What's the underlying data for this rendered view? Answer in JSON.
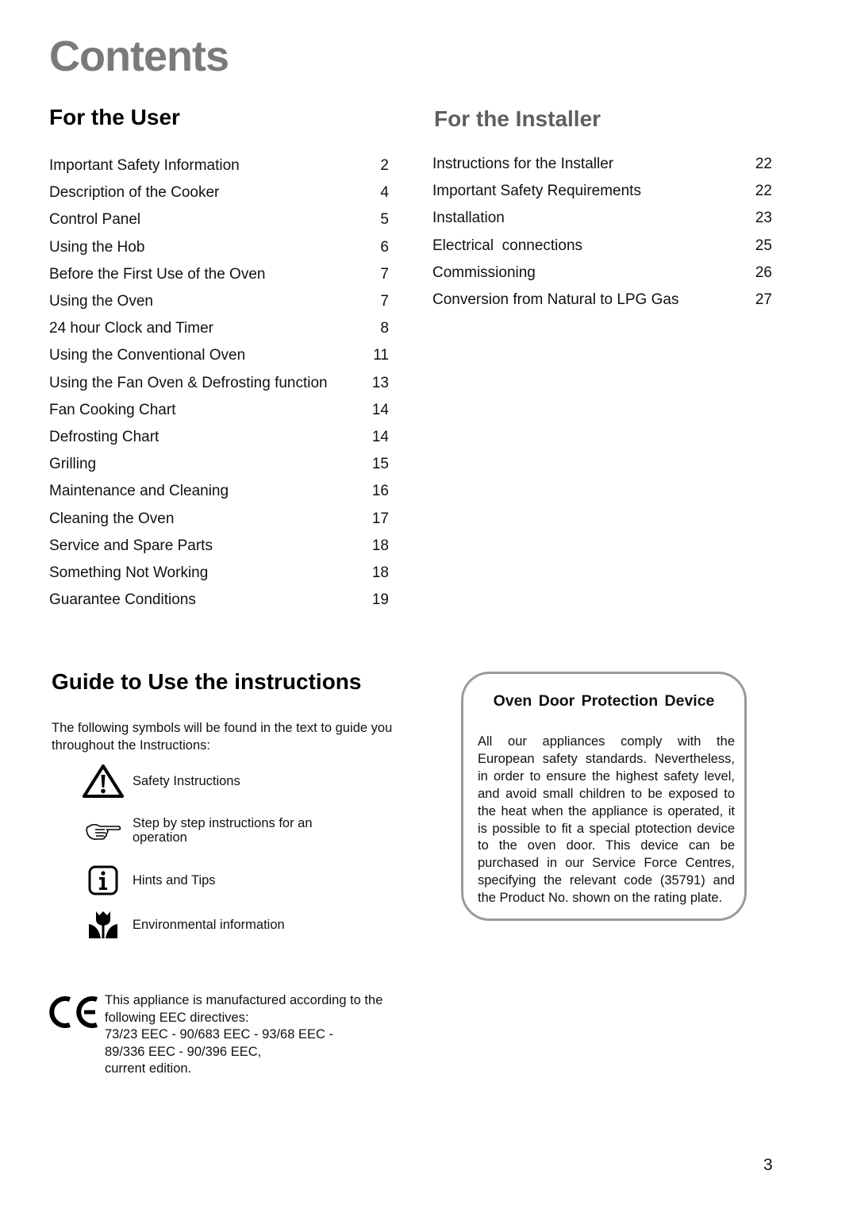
{
  "page": {
    "title": "Contents",
    "page_number": "3"
  },
  "for_user": {
    "heading": "For the User",
    "items": [
      {
        "label": "Important Safety Information",
        "page": "2"
      },
      {
        "label": "Description of the Cooker",
        "page": "4"
      },
      {
        "label": "Control Panel",
        "page": "5"
      },
      {
        "label": "Using the Hob",
        "page": "6"
      },
      {
        "label": "Before the First Use of the Oven",
        "page": "7"
      },
      {
        "label": "Using the Oven",
        "page": "7"
      },
      {
        "label": "24 hour Clock and Timer",
        "page": "8"
      },
      {
        "label": "Using the Conventional Oven",
        "page": "11"
      },
      {
        "label": "Using the Fan Oven & Defrosting function",
        "page": "13"
      },
      {
        "label": "Fan Cooking Chart",
        "page": "14"
      },
      {
        "label": "Defrosting Chart",
        "page": "14"
      },
      {
        "label": "Grilling",
        "page": "15"
      },
      {
        "label": "Maintenance and Cleaning",
        "page": "16"
      },
      {
        "label": "Cleaning the Oven",
        "page": "17"
      },
      {
        "label": "Service and Spare Parts",
        "page": "18"
      },
      {
        "label": "Something Not Working",
        "page": "18"
      },
      {
        "label": "Guarantee Conditions",
        "page": "19"
      }
    ]
  },
  "for_installer": {
    "heading": "For the Installer",
    "items": [
      {
        "label": "Instructions for the Installer",
        "page": "22"
      },
      {
        "label": "Important Safety Requirements",
        "page": "22"
      },
      {
        "label": "Installation",
        "page": "23"
      },
      {
        "label": "Electrical  connections",
        "page": "25"
      },
      {
        "label": "Commissioning",
        "page": "26"
      },
      {
        "label": "Conversion from Natural to LPG Gas",
        "page": "27"
      }
    ]
  },
  "guide": {
    "heading": "Guide to Use the instructions",
    "intro": "The following symbols will be found in the text to guide you throughout the Instructions:",
    "symbols": [
      {
        "icon": "warning-triangle-icon",
        "label": "Safety Instructions"
      },
      {
        "icon": "pointing-hand-icon",
        "label": "Step by step instructions for an operation"
      },
      {
        "icon": "info-icon",
        "label": "Hints and Tips"
      },
      {
        "icon": "tulip-icon",
        "label": "Environmental information"
      }
    ]
  },
  "ce": {
    "icon": "ce-mark-icon",
    "line1": "This appliance is manufactured according to the following EEC directives:",
    "line2": "73/23 EEC - 90/683 EEC - 93/68 EEC - 89/336 EEC - 90/396 EEC,",
    "line3": "current edition."
  },
  "oven_door_box": {
    "title": "Oven Door Protection Device",
    "body": "All our appliances comply with the European safety standards. Nevertheless, in order to ensure the highest safety level, and avoid small children to be exposed to the heat when the appliance is operated, it is possible to fit a special ptotection device to the oven door. This device can be purchased in our Service Force Centres, specifying the relevant code (35791) and the Product No. shown on the rating plate."
  }
}
